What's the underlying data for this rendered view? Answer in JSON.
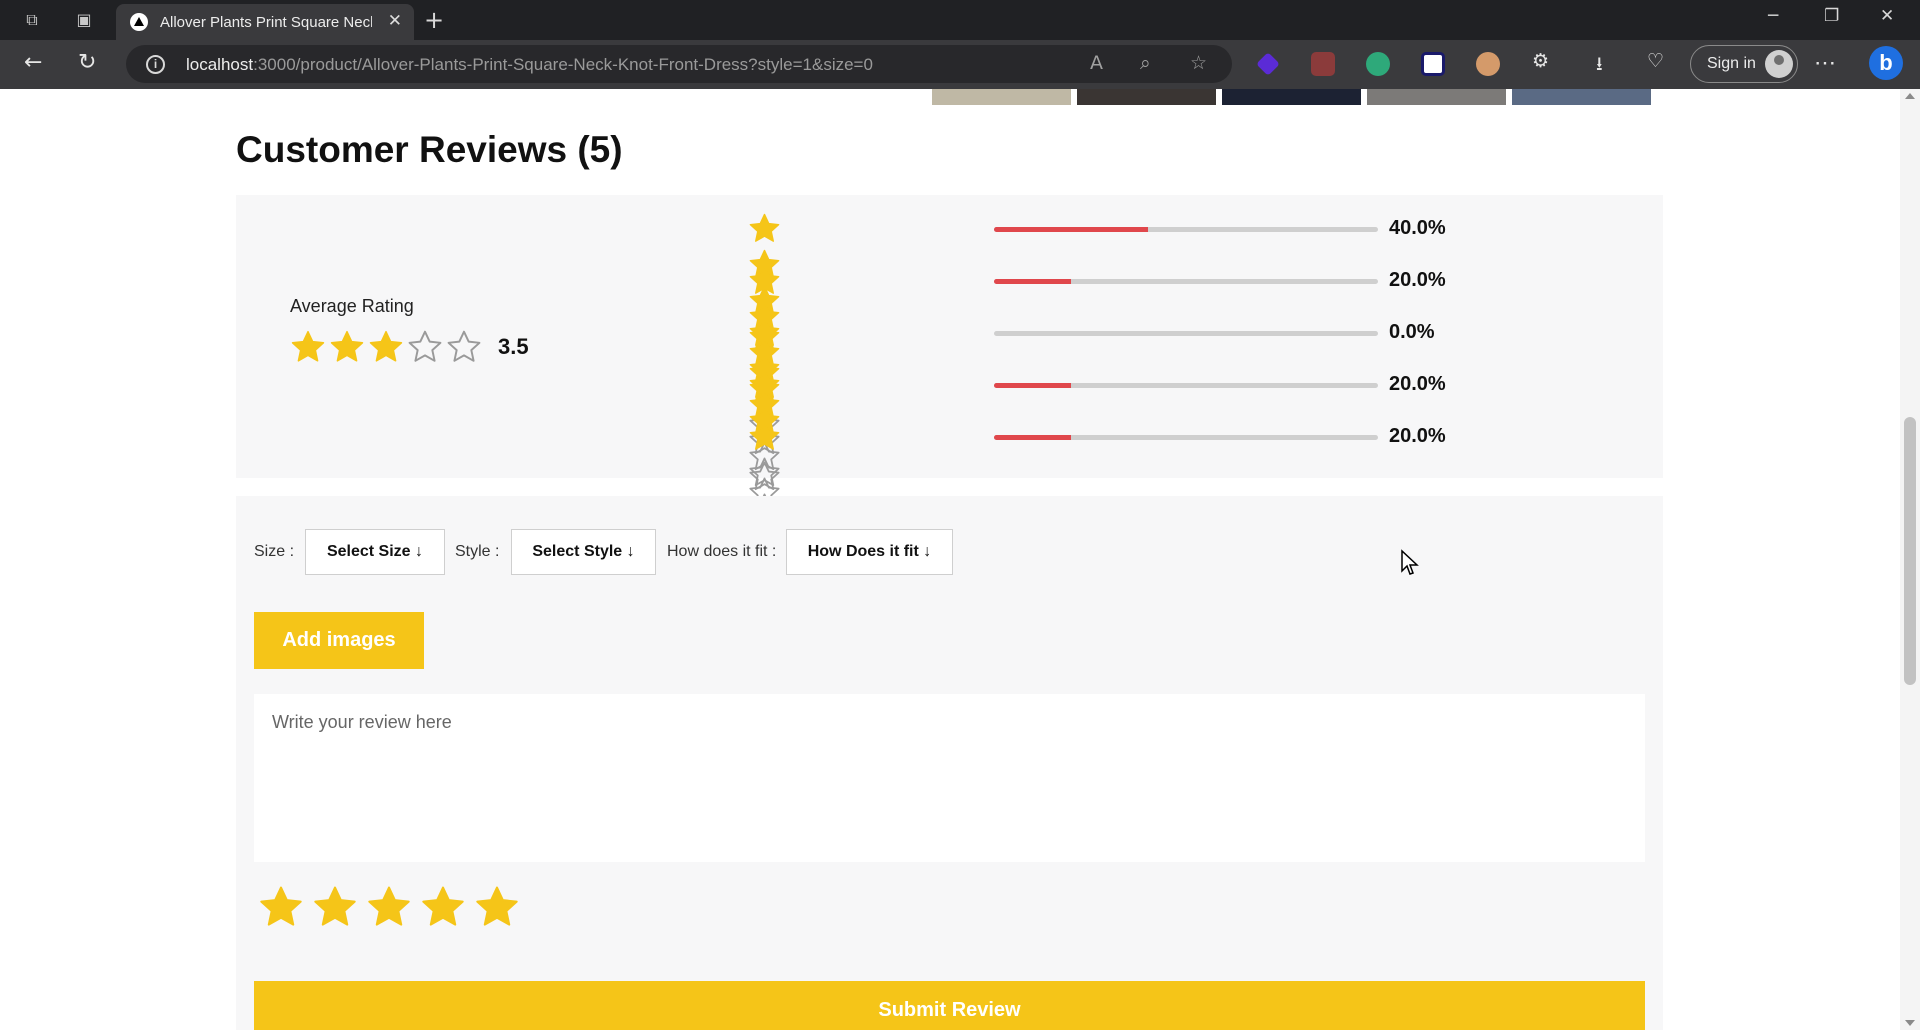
{
  "browser": {
    "tab_title": "Allover Plants Print Square Neck Knot Front Dress",
    "url_host": "localhost",
    "url_rest": ":3000/product/Allover-Plants-Print-Square-Neck-Knot-Front-Dress?style=1&size=0",
    "signin_label": "Sign in",
    "bing_label": "b"
  },
  "reviews": {
    "title": "Customer Reviews (5)",
    "average_label": "Average Rating",
    "average_value": "3.5",
    "average_rating": 3.5,
    "star_color": "#f5c518",
    "bar_color": "#e0474c",
    "breakdown": [
      {
        "stars": 5,
        "percent_label": "40.0%",
        "fraction": 0.4
      },
      {
        "stars": 4,
        "percent_label": "20.0%",
        "fraction": 0.2
      },
      {
        "stars": 3,
        "percent_label": "0.0%",
        "fraction": 0.0
      },
      {
        "stars": 2,
        "percent_label": "20.0%",
        "fraction": 0.2
      },
      {
        "stars": 1,
        "percent_label": "20.0%",
        "fraction": 0.2
      }
    ]
  },
  "form": {
    "size_label": "Size :",
    "size_select": "Select Size",
    "style_label": "Style :",
    "style_select": "Select Style",
    "fit_label": "How does it fit :",
    "fit_select": "How Does it fit",
    "add_images": "Add images",
    "review_placeholder": "Write your review here",
    "selected_rating": 5,
    "submit": "Submit Review"
  }
}
